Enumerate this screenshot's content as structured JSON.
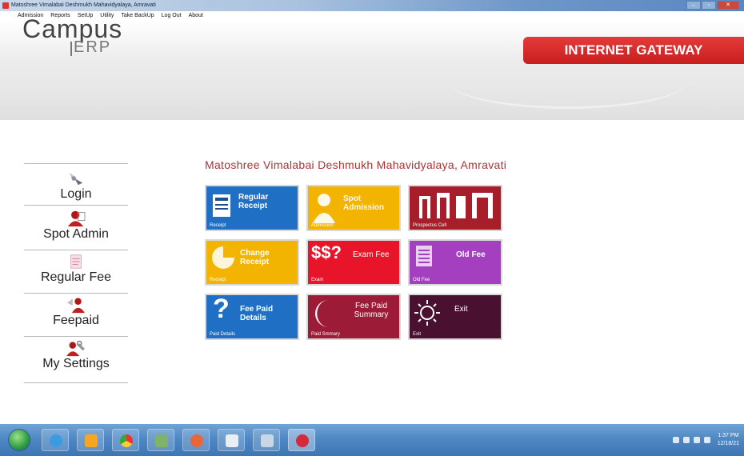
{
  "window": {
    "title": "Matoshree Vimalabai Deshmukh Mahavidyalaya, Amravati"
  },
  "menu": [
    "Admission",
    "Reports",
    "SetUp",
    "Utility",
    "Take BackUp",
    "Log Out",
    "About"
  ],
  "header": {
    "logo_top": "Campus",
    "logo_bottom": "ERP",
    "gateway": "INTERNET GATEWAY"
  },
  "institution": "Matoshree Vimalabai Deshmukh Mahavidyalaya, Amravati",
  "sidebar": [
    {
      "label": "Login",
      "icon": "login-icon"
    },
    {
      "label": "Spot Admin",
      "icon": "user-icon"
    },
    {
      "label": "Regular Fee",
      "icon": "notepad-icon"
    },
    {
      "label": "Feepaid",
      "icon": "users-icon"
    },
    {
      "label": "My Settings",
      "icon": "settings-icon"
    }
  ],
  "tiles": [
    {
      "title": "Regular Receipt",
      "sub": "Receipt",
      "color": "#1f6fc5",
      "icon": "document-icon"
    },
    {
      "title": "Spot Admission",
      "sub": "Admission",
      "color": "#f2b400",
      "icon": "user-icon"
    },
    {
      "title": "",
      "sub": "Prospectus Cell",
      "color": "#a71d2a",
      "icon": "building-icon"
    },
    {
      "title": "Change Receipt",
      "sub": "Receipt",
      "color": "#f2b400",
      "icon": "pie-icon"
    },
    {
      "title": "Exam Fee",
      "sub": "Exam",
      "color": "#e8152a",
      "icon": "dollar-icon",
      "icon_text": "$$?"
    },
    {
      "title": "Old Fee",
      "sub": "Old Fee",
      "color": "#a43fc0",
      "icon": "list-icon"
    },
    {
      "title": "Fee Paid Details",
      "sub": "Paid Details",
      "color": "#1f6fc5",
      "icon": "question-icon",
      "icon_text": "?"
    },
    {
      "title": "Fee Paid Summary",
      "sub": "Paid Smmary",
      "color": "#9c1b36",
      "icon": "crescent-icon"
    },
    {
      "title": "Exit",
      "sub": "Exit",
      "color": "#4a1030",
      "icon": "sun-icon"
    }
  ],
  "taskbar": {
    "clock_time": "1:37 PM",
    "clock_date": "12/18/21"
  }
}
